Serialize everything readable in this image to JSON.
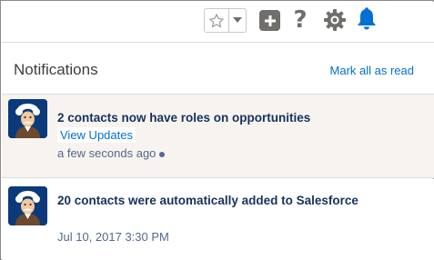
{
  "toolbar": {
    "icons": [
      "star-outline-icon",
      "chevron-down-icon",
      "plus-icon",
      "help-icon",
      "gear-icon",
      "bell-icon"
    ],
    "help_glyph": "?",
    "colors": {
      "icon_gray": "#706e6b",
      "bell_blue": "#0070d2"
    }
  },
  "header": {
    "title": "Notifications",
    "mark_all_label": "Mark all as read"
  },
  "notifications": [
    {
      "title": "2 contacts now have roles on opportunities",
      "link_label": "View Updates",
      "time": "a few seconds ago",
      "unread": true,
      "avatar_icon": "einstein-avatar-icon"
    },
    {
      "title": "20 contacts were automatically added to Salesforce",
      "time": "Jul 10, 2017 3:30 PM",
      "unread": false,
      "avatar_icon": "einstein-avatar-icon"
    }
  ],
  "colors": {
    "unread_bg": "#f7f3ef",
    "link": "#0070d2",
    "title_text": "#16325c",
    "meta_text": "#54698d"
  }
}
